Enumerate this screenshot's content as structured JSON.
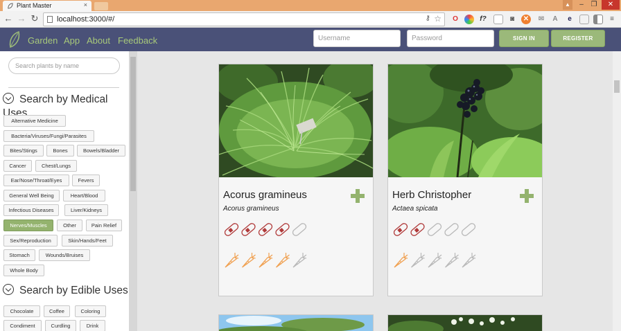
{
  "browser": {
    "tab_title": "Plant Master",
    "tab_close": "×",
    "url": "localhost:3000/#/",
    "window_user": "▲",
    "window_min": "–",
    "window_max": "❐",
    "window_close": "✕"
  },
  "navbar": {
    "links": [
      "Garden",
      "App",
      "About",
      "Feedback"
    ],
    "username_placeholder": "Username",
    "password_placeholder": "Password",
    "sign_in_label": "SIGN IN",
    "register_label": "REGISTER",
    "accent_color": "#a8c97a",
    "background_color": "#4a5178"
  },
  "sidebar": {
    "search_placeholder": "Search plants by name",
    "medical_title": "Search by Medical Uses",
    "medical_tags": [
      "Alternative Medicine",
      "Bacteria/Viruses/Fungi/Parasites",
      "Bites/Stings",
      "Bones",
      "Bowels/Bladder",
      "Cancer",
      "Chest/Lungs",
      "Ear/Nose/Throat/Eyes",
      "Fevers",
      "General Well Being",
      "Heart/Blood",
      "Infectious Diseases",
      "Liver/Kidneys",
      "Nerves/Muscles",
      "Other",
      "Pain Relief",
      "Sex/Reproduction",
      "Skin/Hands/Feet",
      "Stomach",
      "Wounds/Bruises",
      "Whole Body"
    ],
    "active_tag": "Nerves/Muscles",
    "edible_title": "Search by Edible Uses",
    "edible_tags": [
      "Chocolate",
      "Coffee",
      "Coloring",
      "Condiment",
      "Curdling",
      "Drink"
    ]
  },
  "plants": [
    {
      "name": "Acorus gramineus",
      "scientific": "Acorus gramineus",
      "medical_rating": 4,
      "edible_rating": 4,
      "image": "grass-plant-photo"
    },
    {
      "name": "Herb Christopher",
      "scientific": "Actaea spicata",
      "medical_rating": 2,
      "edible_rating": 1,
      "image": "berry-plant-photo"
    }
  ],
  "rating_max": 5,
  "colors": {
    "pill_filled": "#b03a3a",
    "carrot_filled": "#f0a050",
    "empty": "#b8b8b8",
    "plus": "#94b36e"
  }
}
